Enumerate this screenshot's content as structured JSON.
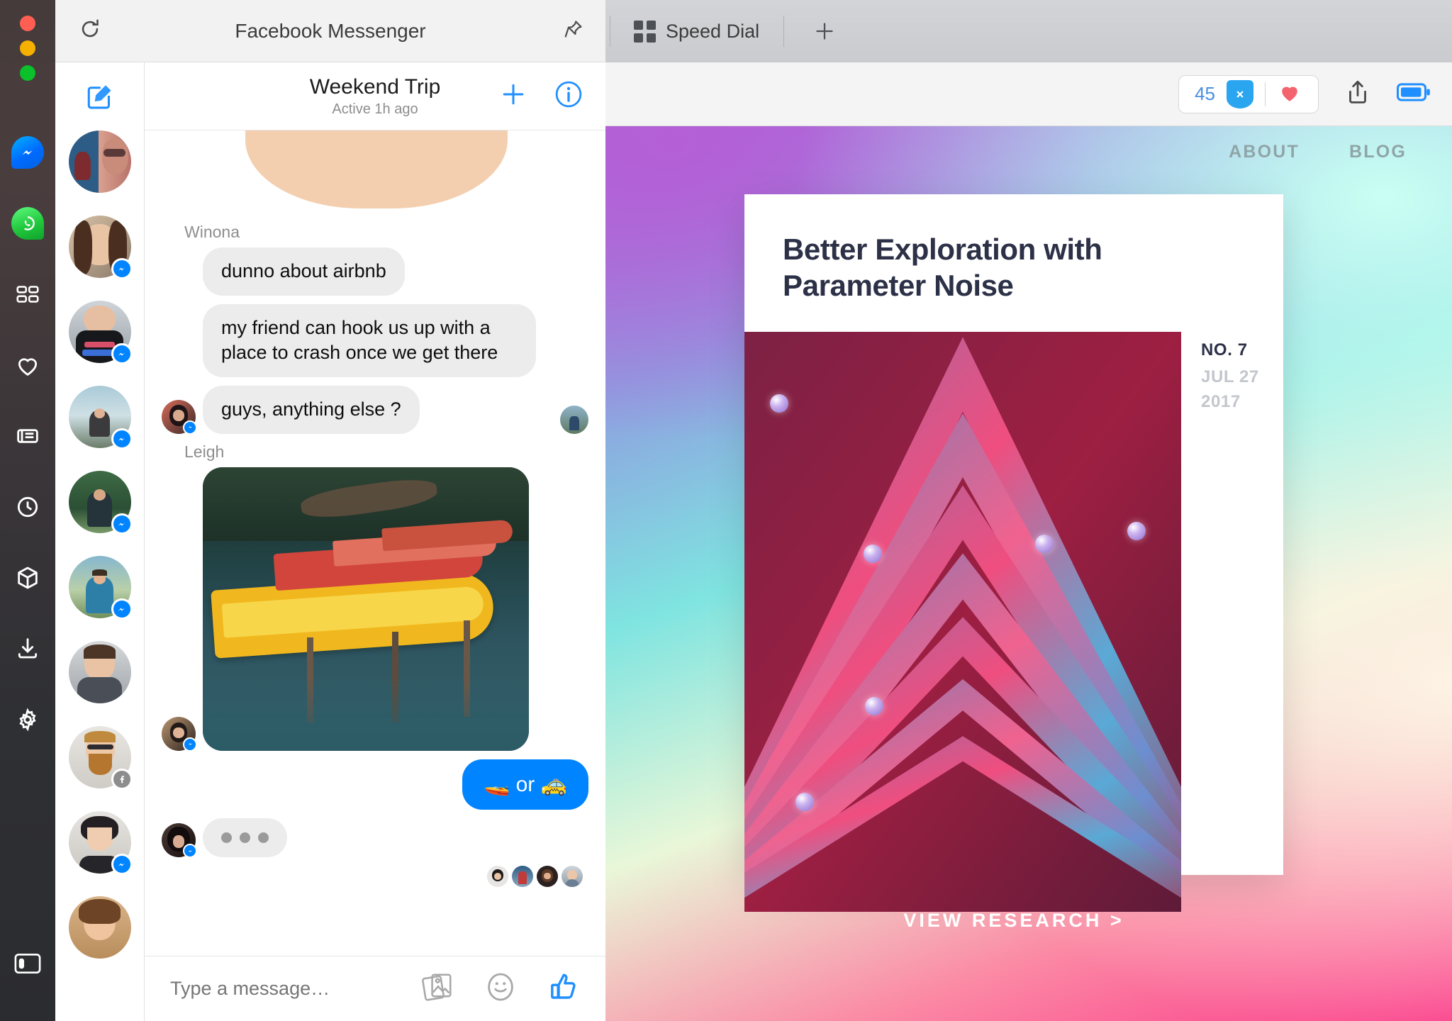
{
  "window": {
    "traffic_lights": [
      "close",
      "minimize",
      "zoom"
    ]
  },
  "rail": {
    "items": [
      {
        "name": "messenger",
        "label": "Messenger",
        "icon": "messenger-icon"
      },
      {
        "name": "whatsapp",
        "label": "WhatsApp",
        "icon": "whatsapp-icon"
      },
      {
        "name": "speed-dial",
        "label": "Speed Dial",
        "icon": "grid-icon"
      },
      {
        "name": "bookmarks",
        "label": "Bookmarks",
        "icon": "heart-icon"
      },
      {
        "name": "news",
        "label": "News",
        "icon": "news-icon"
      },
      {
        "name": "history",
        "label": "History",
        "icon": "clock-icon"
      },
      {
        "name": "extensions",
        "label": "Extensions",
        "icon": "cube-icon"
      },
      {
        "name": "downloads",
        "label": "Downloads",
        "icon": "download-icon"
      },
      {
        "name": "settings",
        "label": "Settings",
        "icon": "gear-icon"
      }
    ],
    "toggle": {
      "name": "sidebar-toggle",
      "label": "Toggle sidebar",
      "icon": "panel-icon"
    }
  },
  "messenger_panel": {
    "title": "Facebook Messenger",
    "reload_label": "Reload",
    "pin_label": "Pin panel",
    "compose_label": "New message",
    "conversation": {
      "name": "Weekend Trip",
      "status": "Active 1h ago",
      "add_people_label": "Add people",
      "info_label": "Conversation information"
    },
    "messages": [
      {
        "sender": "Winona",
        "type": "text",
        "text": "dunno about airbnb",
        "side": "left"
      },
      {
        "sender": "",
        "type": "text",
        "text": "my friend can hook us up with a place to crash once we get there",
        "side": "left"
      },
      {
        "sender": "",
        "type": "text",
        "text": "guys, anything else ?",
        "side": "left"
      },
      {
        "sender": "Leigh",
        "type": "photo",
        "text": "",
        "side": "left"
      },
      {
        "sender": "",
        "type": "emoji",
        "text": "🚤 or 🚕",
        "side": "right"
      },
      {
        "sender": "",
        "type": "typing",
        "text": "•••",
        "side": "left"
      }
    ],
    "composer": {
      "placeholder": "Type a message…",
      "value": "",
      "photo_label": "Send photo",
      "emoji_label": "Choose emoji",
      "like_label": "Send like"
    },
    "contacts_count": 11
  },
  "browser": {
    "tabs": [
      {
        "title": "Speed Dial",
        "icon": "grid-icon",
        "active": true
      }
    ],
    "new_tab_label": "+",
    "toolbar": {
      "blocked_count": "45",
      "ad_block_label": "Ad blocker",
      "heart_label": "Add to bookmarks",
      "share_label": "Share page",
      "battery_label": "Battery saver"
    }
  },
  "page": {
    "nav": [
      {
        "label": "ABOUT"
      },
      {
        "label": "BLOG"
      }
    ],
    "card": {
      "title": "Better Exploration with Parameter Noise",
      "number": "NO. 7",
      "date_line_1": "JUL 27",
      "date_line_2": "2017"
    },
    "cta": "VIEW RESEARCH >"
  },
  "colors": {
    "messenger_blue": "#0084ff",
    "whatsapp_green": "#22c93e",
    "accent_red_heart": "#f4646e",
    "shield_blue": "#2aa5f0",
    "link_blue": "#4a90e2",
    "card_title": "#2c3147",
    "nav_text": "#8fa5a8"
  }
}
